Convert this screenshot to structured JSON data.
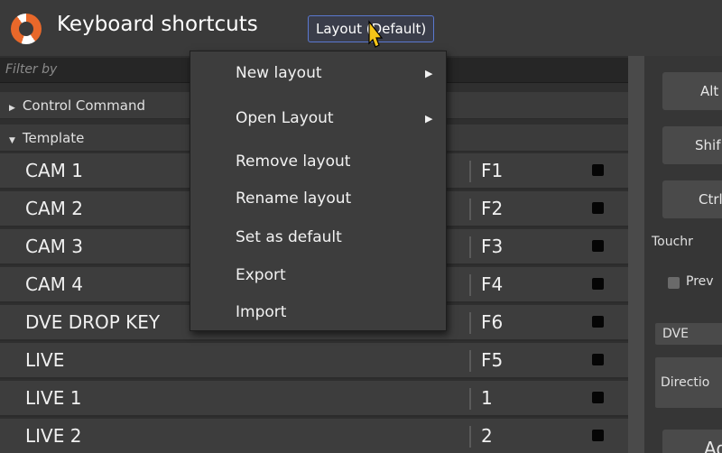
{
  "window": {
    "title": "Keyboard shortcuts",
    "layout_button": "Layout (Default)"
  },
  "filter": {
    "placeholder": "Filter by"
  },
  "groups": [
    {
      "label": "Control Command",
      "expanded": false
    },
    {
      "label": "Template",
      "expanded": true
    }
  ],
  "shortcuts": [
    {
      "name": "CAM 1",
      "key": "F1"
    },
    {
      "name": "CAM 2",
      "key": "F2"
    },
    {
      "name": "CAM 3",
      "key": "F3"
    },
    {
      "name": "CAM 4",
      "key": "F4"
    },
    {
      "name": "DVE DROP KEY",
      "key": "F6"
    },
    {
      "name": "LIVE",
      "key": "F5"
    },
    {
      "name": "LIVE 1",
      "key": "1"
    },
    {
      "name": "LIVE 2",
      "key": "2"
    }
  ],
  "layout_menu": {
    "items": [
      {
        "label": "New layout",
        "submenu": true
      },
      {
        "label": "Open Layout",
        "submenu": true
      },
      {
        "label": "Remove layout",
        "submenu": false
      },
      {
        "label": "Rename layout",
        "submenu": false
      },
      {
        "label": "Set as default",
        "submenu": false
      },
      {
        "label": "Export",
        "submenu": false
      },
      {
        "label": "Import",
        "submenu": false
      }
    ]
  },
  "right_panel": {
    "alt_label": "Alt",
    "shift_label": "Shif",
    "ctrl_label": "Ctrl",
    "touch_label": "Touchr",
    "preview_label": "Prev",
    "dve_label": "DVE",
    "direction_label": "Directio",
    "add_label": "Ad"
  },
  "colors": {
    "accent_border": "#5a78d0",
    "logo_orange": "#e8682a",
    "cursor_yellow": "#f5c518"
  }
}
